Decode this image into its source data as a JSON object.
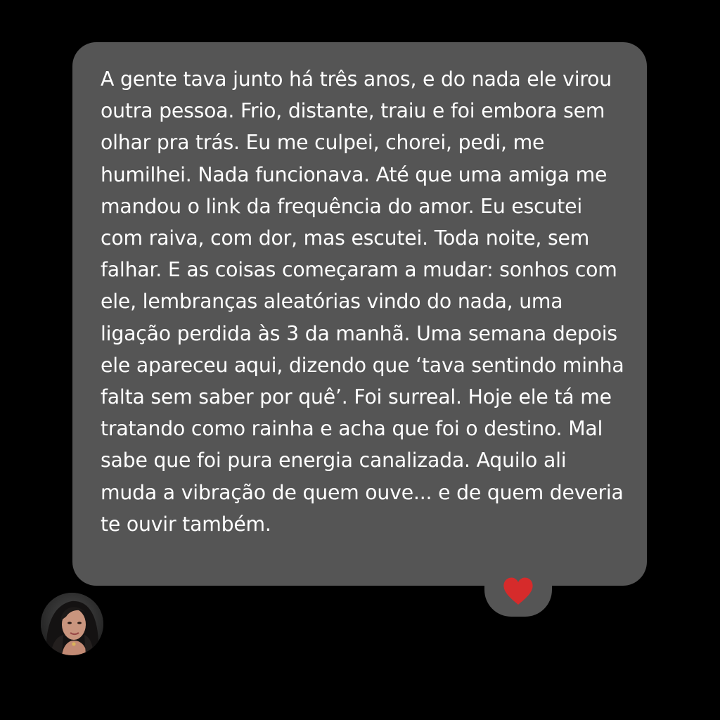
{
  "message": {
    "text": "A gente tava junto há três anos, e do nada ele virou outra pessoa. Frio, distante, traiu e foi embora sem olhar pra trás. Eu me culpei, chorei, pedi, me humilhei. Nada funcionava. Até que uma amiga me mandou o link da frequência do amor. Eu escutei com raiva, com dor, mas escutei. Toda noite, sem falhar. E as coisas começaram a mudar: sonhos com ele, lembranças aleatórias vindo do nada, uma ligação perdida às 3 da manhã. Uma semana depois ele apareceu aqui, dizendo que ‘tava sentindo minha falta sem saber por quê’. Foi surreal. Hoje ele tá me tratando como rainha e acha que foi o destino. Mal sabe que foi pura energia canalizada. Aquilo ali muda a vibração de quem ouve... e de quem deveria te ouvir também.",
    "reaction_icon": "heart-icon",
    "reaction_color": "#d62b2b",
    "bubble_color": "#555555",
    "text_color": "#ffffff"
  },
  "sender": {
    "avatar_icon": "avatar"
  },
  "page": {
    "background": "#000000"
  }
}
